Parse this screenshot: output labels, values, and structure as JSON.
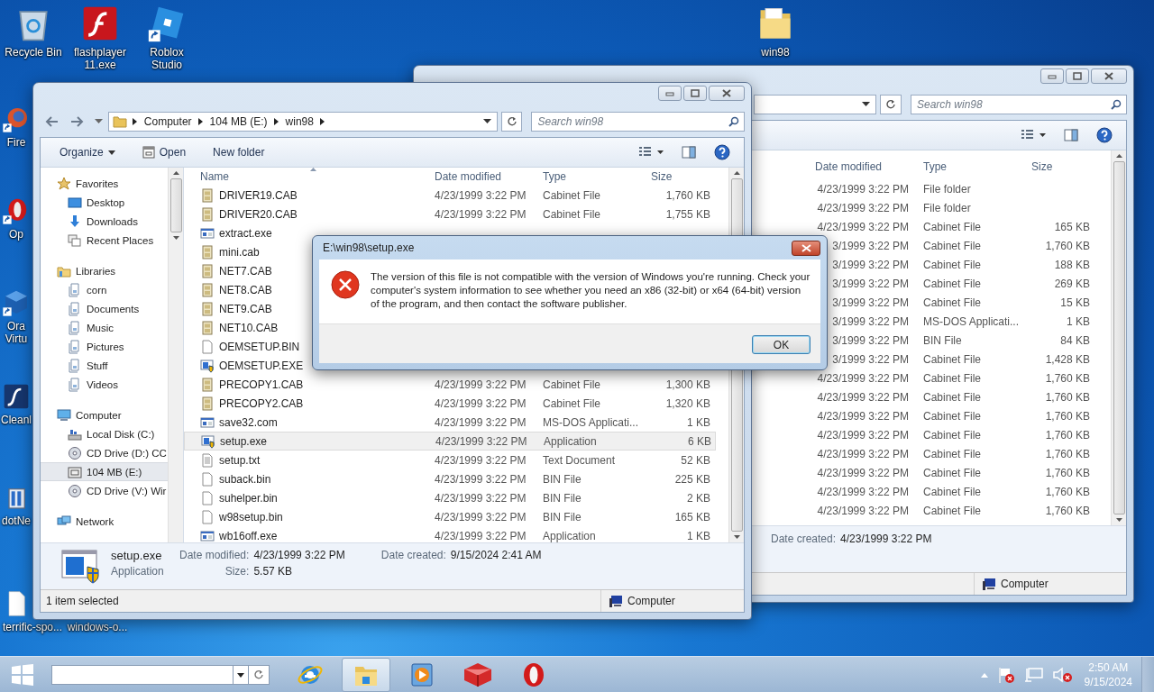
{
  "desktop": {
    "icons": [
      {
        "label": "Recycle Bin",
        "kind": "recycle"
      },
      {
        "label": "flashplayer 11.exe",
        "kind": "flash"
      },
      {
        "label": "Roblox Studio",
        "kind": "roblox"
      },
      {
        "label": "win98",
        "kind": "folder"
      },
      {
        "label": "Fire",
        "kind": "firefox"
      },
      {
        "label": "Op",
        "kind": "opera"
      },
      {
        "label": "Ora Virtu",
        "kind": "vbox"
      },
      {
        "label": "Cleanl",
        "kind": "cleaner"
      },
      {
        "label": "dotNe",
        "kind": "installer"
      },
      {
        "label": "terrific-spo...",
        "kind": "document"
      },
      {
        "label": "windows-o..."
      }
    ]
  },
  "explorer_back": {
    "search": {
      "placeholder": "Search win98"
    },
    "columns": [
      "Date modified",
      "Type",
      "Size"
    ],
    "rows": [
      {
        "date": "4/23/1999 3:22 PM",
        "type": "File folder"
      },
      {
        "date": "4/23/1999 3:22 PM",
        "type": "File folder"
      },
      {
        "date": "4/23/1999 3:22 PM",
        "type": "Cabinet File",
        "size": "165 KB"
      },
      {
        "date": "3/1999 3:22 PM",
        "type": "Cabinet File",
        "size": "1,760 KB"
      },
      {
        "date": "3/1999 3:22 PM",
        "type": "Cabinet File",
        "size": "188 KB"
      },
      {
        "date": "3/1999 3:22 PM",
        "type": "Cabinet File",
        "size": "269 KB"
      },
      {
        "date": "3/1999 3:22 PM",
        "type": "Cabinet File",
        "size": "15 KB"
      },
      {
        "date": "3/1999 3:22 PM",
        "type": "MS-DOS Applicati...",
        "size": "1 KB"
      },
      {
        "date": "3/1999 3:22 PM",
        "type": "BIN File",
        "size": "84 KB"
      },
      {
        "date": "3/1999 3:22 PM",
        "type": "Cabinet File",
        "size": "1,428 KB"
      },
      {
        "date": "4/23/1999 3:22 PM",
        "type": "Cabinet File",
        "size": "1,760 KB"
      },
      {
        "date": "4/23/1999 3:22 PM",
        "type": "Cabinet File",
        "size": "1,760 KB"
      },
      {
        "date": "4/23/1999 3:22 PM",
        "type": "Cabinet File",
        "size": "1,760 KB"
      },
      {
        "date": "4/23/1999 3:22 PM",
        "type": "Cabinet File",
        "size": "1,760 KB"
      },
      {
        "date": "4/23/1999 3:22 PM",
        "type": "Cabinet File",
        "size": "1,760 KB"
      },
      {
        "date": "4/23/1999 3:22 PM",
        "type": "Cabinet File",
        "size": "1,760 KB"
      },
      {
        "date": "4/23/1999 3:22 PM",
        "type": "Cabinet File",
        "size": "1,760 KB"
      },
      {
        "date": "4/23/1999 3:22 PM",
        "type": "Cabinet File",
        "size": "1,760 KB"
      }
    ],
    "details": {
      "label": "Date created:",
      "value": "4/23/1999 3:22 PM"
    },
    "status": {
      "location": "Computer"
    }
  },
  "explorer": {
    "breadcrumb": [
      "Computer",
      "104 MB (E:)",
      "win98"
    ],
    "search": {
      "placeholder": "Search win98"
    },
    "toolbar": [
      {
        "label": "Organize",
        "kind": "menu"
      },
      {
        "label": "Open",
        "kind": "open"
      },
      {
        "label": "New folder",
        "kind": "plain"
      }
    ],
    "nav": [
      {
        "label": "Favorites",
        "kind": "star",
        "selected": false,
        "children": [
          {
            "label": "Desktop",
            "kind": "desktop",
            "selected": false
          },
          {
            "label": "Downloads",
            "kind": "download",
            "selected": false
          },
          {
            "label": "Recent Places",
            "kind": "recent",
            "selected": false
          }
        ]
      },
      {
        "label": "Libraries",
        "kind": "library",
        "selected": false,
        "children": [
          {
            "label": "corn",
            "kind": "libitem",
            "selected": false
          },
          {
            "label": "Documents",
            "kind": "libitem",
            "selected": false
          },
          {
            "label": "Music",
            "kind": "libitem",
            "selected": false
          },
          {
            "label": "Pictures",
            "kind": "libitem",
            "selected": false
          },
          {
            "label": "Stuff",
            "kind": "libitem",
            "selected": false
          },
          {
            "label": "Videos",
            "kind": "libitem",
            "selected": false
          }
        ]
      },
      {
        "label": "Computer",
        "kind": "computer",
        "selected": false,
        "children": [
          {
            "label": "Local Disk (C:)",
            "kind": "disk",
            "selected": false
          },
          {
            "label": "CD Drive (D:) CC",
            "kind": "cd",
            "selected": false
          },
          {
            "label": "104 MB (E:)",
            "kind": "removable",
            "selected": true
          },
          {
            "label": "CD Drive (V:) Wir",
            "kind": "cd",
            "selected": false
          }
        ]
      },
      {
        "label": "Network",
        "kind": "network",
        "selected": false
      }
    ],
    "columns": [
      "Name",
      "Date modified",
      "Type",
      "Size"
    ],
    "rows": [
      {
        "name": "DRIVER19.CAB",
        "kind": "cab",
        "date": "4/23/1999 3:22 PM",
        "type": "Cabinet File",
        "size": "1,760 KB",
        "selected": false
      },
      {
        "name": "DRIVER20.CAB",
        "kind": "cab",
        "date": "4/23/1999 3:22 PM",
        "type": "Cabinet File",
        "size": "1,755 KB",
        "selected": false
      },
      {
        "name": "extract.exe",
        "kind": "app",
        "selected": false
      },
      {
        "name": "mini.cab",
        "kind": "cab",
        "selected": false
      },
      {
        "name": "NET7.CAB",
        "kind": "cab",
        "selected": false
      },
      {
        "name": "NET8.CAB",
        "kind": "cab",
        "selected": false
      },
      {
        "name": "NET9.CAB",
        "kind": "cab",
        "selected": false
      },
      {
        "name": "NET10.CAB",
        "kind": "cab",
        "selected": false
      },
      {
        "name": "OEMSETUP.BIN",
        "kind": "blank",
        "selected": false
      },
      {
        "name": "OEMSETUP.EXE",
        "kind": "setup",
        "selected": false
      },
      {
        "name": "PRECOPY1.CAB",
        "kind": "cab",
        "date": "4/23/1999 3:22 PM",
        "type": "Cabinet File",
        "size": "1,300 KB",
        "selected": false
      },
      {
        "name": "PRECOPY2.CAB",
        "kind": "cab",
        "date": "4/23/1999 3:22 PM",
        "type": "Cabinet File",
        "size": "1,320 KB",
        "selected": false
      },
      {
        "name": "save32.com",
        "kind": "app",
        "date": "4/23/1999 3:22 PM",
        "type": "MS-DOS Applicati...",
        "size": "1 KB",
        "selected": false
      },
      {
        "name": "setup.exe",
        "kind": "setup",
        "date": "4/23/1999 3:22 PM",
        "type": "Application",
        "size": "6 KB",
        "selected": true
      },
      {
        "name": "setup.txt",
        "kind": "text",
        "date": "4/23/1999 3:22 PM",
        "type": "Text Document",
        "size": "52 KB",
        "selected": false
      },
      {
        "name": "suback.bin",
        "kind": "blank",
        "date": "4/23/1999 3:22 PM",
        "type": "BIN File",
        "size": "225 KB",
        "selected": false
      },
      {
        "name": "suhelper.bin",
        "kind": "blank",
        "date": "4/23/1999 3:22 PM",
        "type": "BIN File",
        "size": "2 KB",
        "selected": false
      },
      {
        "name": "w98setup.bin",
        "kind": "blank",
        "date": "4/23/1999 3:22 PM",
        "type": "BIN File",
        "size": "165 KB",
        "selected": false
      },
      {
        "name": "wb16off.exe",
        "kind": "app",
        "date": "4/23/1999 3:22 PM",
        "type": "Application",
        "size": "1 KB",
        "selected": false
      }
    ],
    "details": {
      "name": "setup.exe",
      "type": "Application",
      "fields": [
        {
          "label": "Date modified:",
          "value": "4/23/1999 3:22 PM"
        },
        {
          "label": "Size:",
          "value": "5.57 KB"
        },
        {
          "label": "Date created:",
          "value": "9/15/2024 2:41 AM"
        }
      ]
    },
    "status": {
      "text": "1 item selected",
      "location": "Computer"
    }
  },
  "dialog": {
    "title": "E:\\win98\\setup.exe",
    "message": "The version of this file is not compatible with the version of Windows you're running. Check your computer's system information to see whether you need an x86 (32-bit) or x64 (64-bit) version of the program, and then contact the software publisher.",
    "button": "OK"
  },
  "taskbar": {
    "pinned": [
      {
        "kind": "ie",
        "active": false
      },
      {
        "kind": "explorer",
        "active": true
      },
      {
        "kind": "media",
        "active": false
      },
      {
        "kind": "redbox",
        "active": false
      },
      {
        "kind": "opera",
        "active": false
      }
    ],
    "clock": {
      "time": "2:50 AM",
      "date": "9/15/2024"
    }
  }
}
